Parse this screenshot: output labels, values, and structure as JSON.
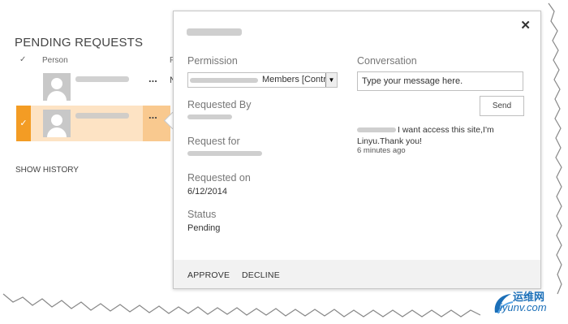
{
  "page": {
    "title": "PENDING REQUESTS",
    "columns": {
      "check": "✓",
      "person": "Person",
      "next": "F"
    },
    "rows": [
      {
        "ellipsis": "...",
        "trunc": "N"
      },
      {
        "ellipsis": "..."
      }
    ],
    "show_history": "SHOW HISTORY"
  },
  "callout": {
    "close": "✕",
    "permission": {
      "label": "Permission",
      "value": "Members [Contribute]"
    },
    "requested_by": {
      "label": "Requested By"
    },
    "request_for": {
      "label": "Request for"
    },
    "requested_on": {
      "label": "Requested on",
      "value": "6/12/2014"
    },
    "status": {
      "label": "Status",
      "value": "Pending"
    },
    "conversation": {
      "label": "Conversation",
      "placeholder": "Type your message here.",
      "send_label": "Send",
      "message_text": "I want access this site,I'm Linyu.Thank you!",
      "message_time": "6 minutes ago"
    },
    "footer": {
      "approve": "APPROVE",
      "decline": "DECLINE"
    }
  },
  "watermark": {
    "cn": "运维网",
    "en": "iyunv.com"
  }
}
